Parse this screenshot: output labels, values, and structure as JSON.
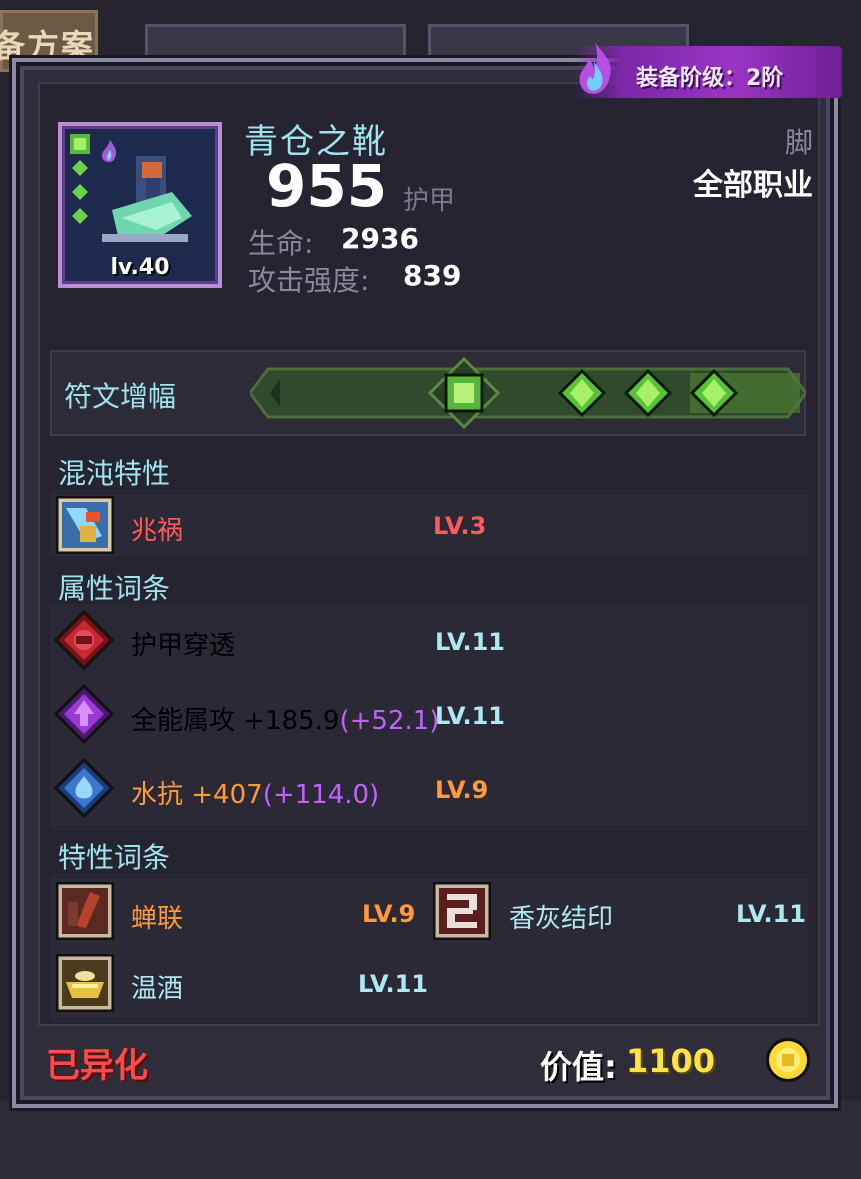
{
  "background": {
    "left_tab_text": "备方案"
  },
  "header": {
    "grade_label": "装备阶级：2阶"
  },
  "item": {
    "name": "青仓之靴",
    "level_label": "lv.40",
    "armor_value": "955",
    "armor_label": "护甲",
    "slot": "脚",
    "class_restriction": "全部职业",
    "stats": [
      {
        "label": "生命:",
        "value": "2936"
      },
      {
        "label": "攻击强度:",
        "value": "839"
      }
    ]
  },
  "rune": {
    "label": "符文增幅",
    "icons": [
      "rune-gem-square-icon",
      "rune-gem-diamond-icon",
      "rune-gem-diamond-icon",
      "rune-gem-diamond-icon"
    ]
  },
  "chaos": {
    "title": "混沌特性",
    "items": [
      {
        "name": "兆祸",
        "level": "LV.3",
        "icon": "omen-icon",
        "color": "#ff5a5a"
      }
    ]
  },
  "attributes": {
    "title": "属性词条",
    "items": [
      {
        "name": "护甲穿透",
        "bonus": "",
        "level": "LV.11",
        "icon": "armor-pen-gem-icon",
        "name_color": "#aee8f2",
        "level_color": "#aee8f2"
      },
      {
        "name": "全能属攻 +185.9",
        "bonus": "(+52.1)",
        "level": "LV.11",
        "icon": "arcane-gem-icon",
        "name_color": "#aee8f2",
        "level_color": "#aee8f2"
      },
      {
        "name": "水抗 +407",
        "bonus": "(+114.0)",
        "level": "LV.9",
        "icon": "water-gem-icon",
        "name_color": "#ff9a3a",
        "level_color": "#ff9a3a"
      }
    ]
  },
  "traits": {
    "title": "特性词条",
    "items": [
      {
        "name": "蝉联",
        "level": "LV.9",
        "icon": "cicada-icon",
        "color": "#ff9a3a"
      },
      {
        "name": "香灰结印",
        "level": "LV.11",
        "icon": "incense-seal-icon",
        "color": "#aee8f2"
      },
      {
        "name": "温酒",
        "level": "LV.11",
        "icon": "warm-wine-icon",
        "color": "#aee8f2"
      }
    ]
  },
  "footer": {
    "status": "已异化",
    "value_label": "价值:",
    "value": "1100"
  },
  "colors": {
    "accent_cyan": "#9ee3ee",
    "gold": "#ffe14a",
    "panel_border": "#8d8aa6"
  }
}
